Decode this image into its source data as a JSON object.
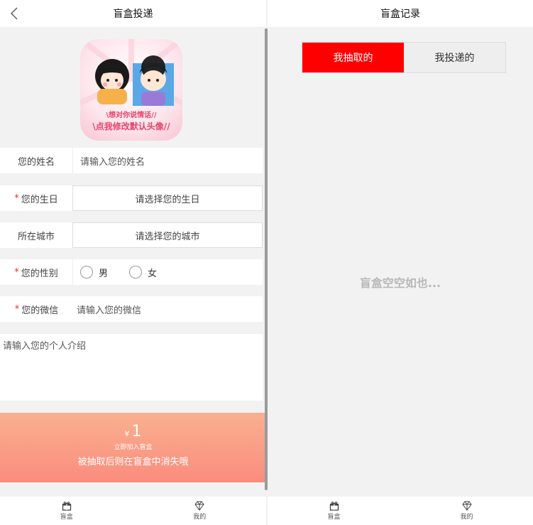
{
  "left": {
    "title": "盲盒投递",
    "avatar_text_top": "\\想对你说情话//",
    "avatar_text_bottom": "\\点我修改默认头像//",
    "name": {
      "label": "您的姓名",
      "placeholder": "请输入您的姓名"
    },
    "birthday": {
      "label": "您的生日",
      "required": "*",
      "value": "请选择您的生日"
    },
    "city": {
      "label": "所在城市",
      "value": "请选择您的城市"
    },
    "gender": {
      "label": "您的性别",
      "required": "*",
      "options": [
        "男",
        "女"
      ]
    },
    "wechat": {
      "label": "您的微信",
      "required": "*",
      "placeholder": "请输入您的微信"
    },
    "intro_placeholder": "请输入您的个人介绍",
    "price_symbol": "¥",
    "price": "1",
    "join_label": "立即加入盲盒",
    "hint": "被抽取后则在盲盒中消失哦",
    "tabs": [
      "盲盒",
      "我的"
    ]
  },
  "right": {
    "title": "盲盒记录",
    "seg": [
      "我抽取的",
      "我投递的"
    ],
    "empty": "盲盒空空如也...",
    "tabs": [
      "盲盒",
      "我的"
    ]
  },
  "colors": {
    "accent": "#ff0000",
    "pay_top": "#f9b08f",
    "pay_bottom": "#fb8c7e",
    "required": "#e6322d"
  }
}
